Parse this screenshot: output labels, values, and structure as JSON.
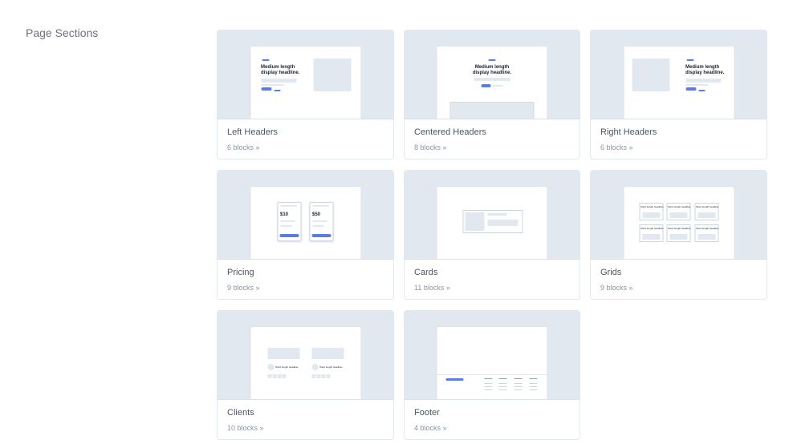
{
  "page": {
    "title": "Page Sections"
  },
  "cards": [
    {
      "title": "Left Headers",
      "count": "6 blocks »",
      "headline": "Medium length\ndisplay headline."
    },
    {
      "title": "Centered Headers",
      "count": "8 blocks »",
      "headline": "Medium length\ndisplay headline."
    },
    {
      "title": "Right Headers",
      "count": "6 blocks »",
      "headline": "Medium length\ndisplay headline."
    },
    {
      "title": "Pricing",
      "count": "9 blocks »",
      "prices": [
        "$10",
        "$50"
      ]
    },
    {
      "title": "Cards",
      "count": "11 blocks »"
    },
    {
      "title": "Grids",
      "count": "9 blocks »",
      "grid_label": "Short length headline."
    },
    {
      "title": "Clients",
      "count": "10 blocks »",
      "client_label": "Short length headline."
    },
    {
      "title": "Footer",
      "count": "4 blocks »"
    }
  ],
  "colors": {
    "accent": "#5a7bea",
    "thumb_bg": "#e2e8f0",
    "text": "#4a5568",
    "muted": "#8a94a6"
  }
}
